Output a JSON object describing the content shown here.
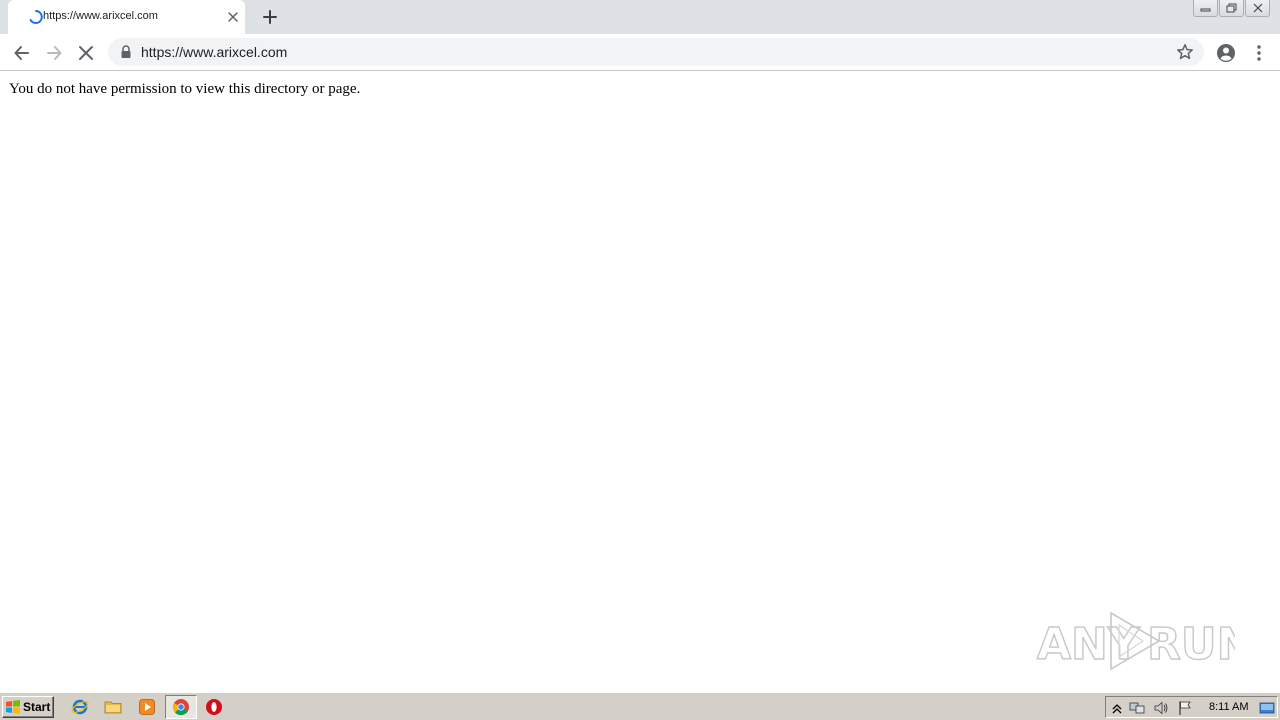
{
  "browser": {
    "tab": {
      "title": "https://www.arixcel.com",
      "loading": true
    },
    "address_bar": {
      "url": "https://www.arixcel.com"
    }
  },
  "page": {
    "message": "You do not have permission to view this directory or page."
  },
  "watermark": {
    "text_left": "ANY",
    "text_right": "RUN"
  },
  "taskbar": {
    "start_label": "Start",
    "pinned_apps": [
      "internet-explorer-icon",
      "folder-icon",
      "media-player-icon",
      "chrome-icon",
      "opera-icon"
    ],
    "active_app": "chrome-icon",
    "clock": "8:11 AM"
  },
  "colors": {
    "tabstrip": "#dee1e6",
    "omnibox": "#f1f3f4",
    "spinner": "#1a73e8",
    "taskbar": "#d4d0c8"
  }
}
